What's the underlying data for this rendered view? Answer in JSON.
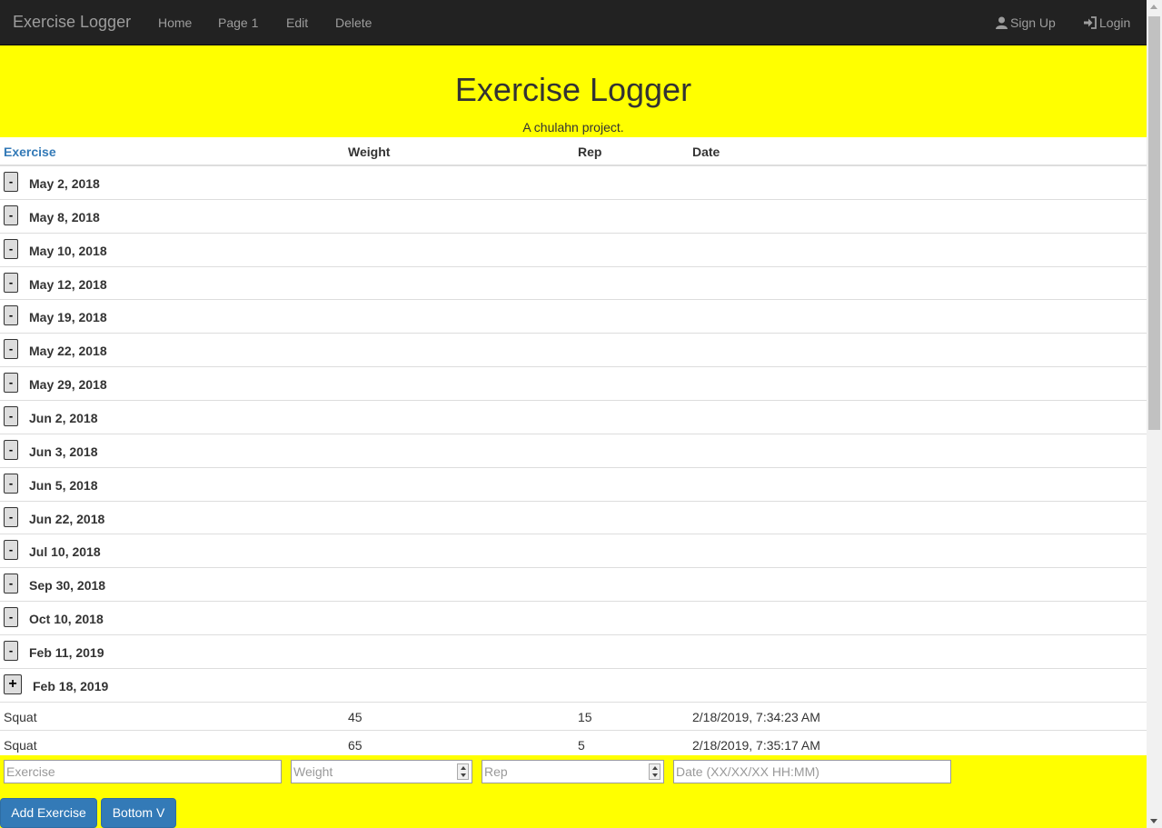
{
  "navbar": {
    "brand": "Exercise Logger",
    "links": [
      "Home",
      "Page 1",
      "Edit",
      "Delete"
    ],
    "signup": "Sign Up",
    "login": "Login"
  },
  "jumbotron": {
    "title": "Exercise Logger",
    "subtitle": "A chulahn project."
  },
  "table": {
    "headers": [
      "Exercise",
      "Weight",
      "Rep",
      "Date"
    ],
    "groups": [
      {
        "date": "May 2, 2018",
        "toggle": "-"
      },
      {
        "date": "May 8, 2018",
        "toggle": "-"
      },
      {
        "date": "May 10, 2018",
        "toggle": "-"
      },
      {
        "date": "May 12, 2018",
        "toggle": "-"
      },
      {
        "date": "May 19, 2018",
        "toggle": "-"
      },
      {
        "date": "May 22, 2018",
        "toggle": "-"
      },
      {
        "date": "May 29, 2018",
        "toggle": "-"
      },
      {
        "date": "Jun 2, 2018",
        "toggle": "-"
      },
      {
        "date": "Jun 3, 2018",
        "toggle": "-"
      },
      {
        "date": "Jun 5, 2018",
        "toggle": "-"
      },
      {
        "date": "Jun 22, 2018",
        "toggle": "-"
      },
      {
        "date": "Jul 10, 2018",
        "toggle": "-"
      },
      {
        "date": "Sep 30, 2018",
        "toggle": "-"
      },
      {
        "date": "Oct 10, 2018",
        "toggle": "-"
      },
      {
        "date": "Feb 11, 2019",
        "toggle": "-"
      },
      {
        "date": "Feb 18, 2019",
        "toggle": "+"
      }
    ],
    "entries": [
      {
        "exercise": "Squat",
        "weight": "45",
        "rep": "15",
        "date": "2/18/2019, 7:34:23 AM"
      },
      {
        "exercise": "Squat",
        "weight": "65",
        "rep": "5",
        "date": "2/18/2019, 7:35:17 AM"
      }
    ]
  },
  "form": {
    "exercise_placeholder": "Exercise",
    "weight_placeholder": "Weight",
    "rep_placeholder": "Rep",
    "date_placeholder": "Date (XX/XX/XX HH:MM)",
    "add_button": "Add Exercise",
    "bottom_button": "Bottom V"
  },
  "colors": {
    "navbar": "#222222",
    "jumbotron": "#ffff00",
    "primary_button": "#337ab7"
  }
}
